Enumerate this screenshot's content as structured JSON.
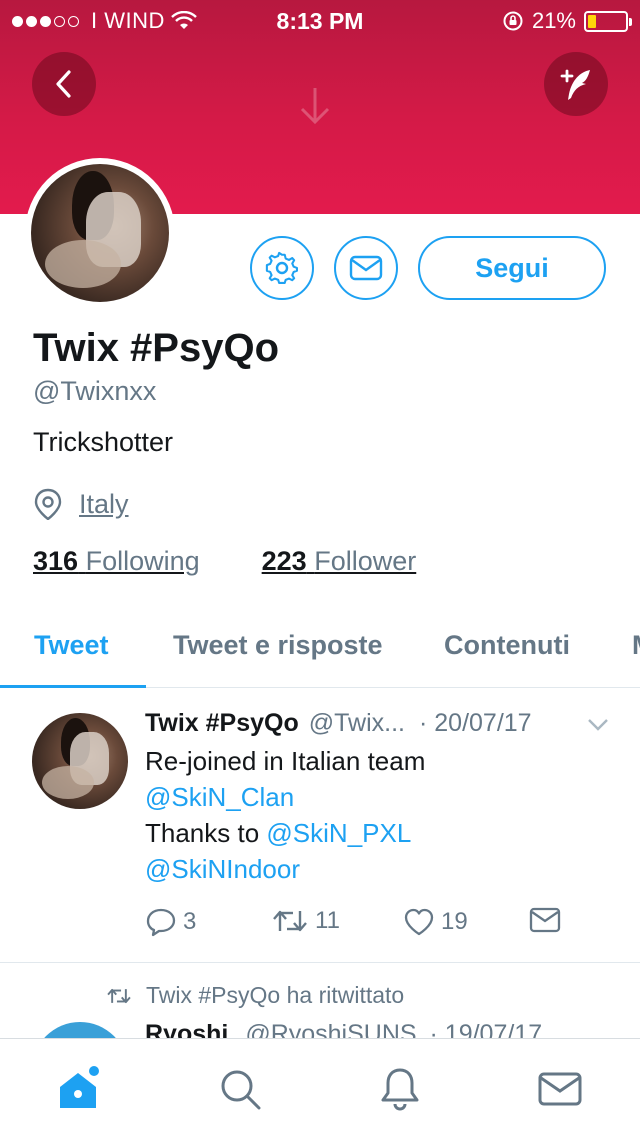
{
  "status_bar": {
    "carrier": "I WIND",
    "time": "8:13 PM",
    "battery": "21%",
    "battery_level": 0.21
  },
  "profile": {
    "name": "Twix #PsyQo",
    "handle": "@Twixnxx",
    "bio": "Trickshotter",
    "location": "Italy",
    "following_count": "316",
    "following_label": "Following",
    "follower_count": "223",
    "follower_label": "Follower",
    "follow_button": "Segui"
  },
  "tabs": [
    {
      "label": "Tweet",
      "active": true
    },
    {
      "label": "Tweet e risposte",
      "active": false
    },
    {
      "label": "Contenuti",
      "active": false
    },
    {
      "label": "M",
      "active": false
    }
  ],
  "tweet": {
    "name": "Twix #PsyQo",
    "handle": "@Twix...",
    "date": "· 20/07/17",
    "line1": "Re-joined in Italian team",
    "mention1": "@SkiN_Clan",
    "line3": "Thanks to ",
    "mention2": "@SkiN_PXL",
    "mention3": "@SkiNIndoor",
    "replies": "3",
    "retweets": "11",
    "likes": "19"
  },
  "retweet_notice": "Twix #PsyQo ha ritwittato",
  "next_tweet": {
    "name": "Ryoshi",
    "handle": "@RyoshiSUNS",
    "date": "· 19/07/17"
  },
  "colors": {
    "accent": "#1da1f2",
    "banner": "#d41a47",
    "secondary_text": "#657786"
  },
  "icons": {
    "back": "chevron-left-icon",
    "compose": "compose-feather-icon",
    "settings": "gear-icon",
    "message": "envelope-icon",
    "location": "location-pin-icon",
    "home": "home-icon",
    "search": "search-icon",
    "notifications": "bell-icon",
    "messages": "envelope-icon"
  }
}
